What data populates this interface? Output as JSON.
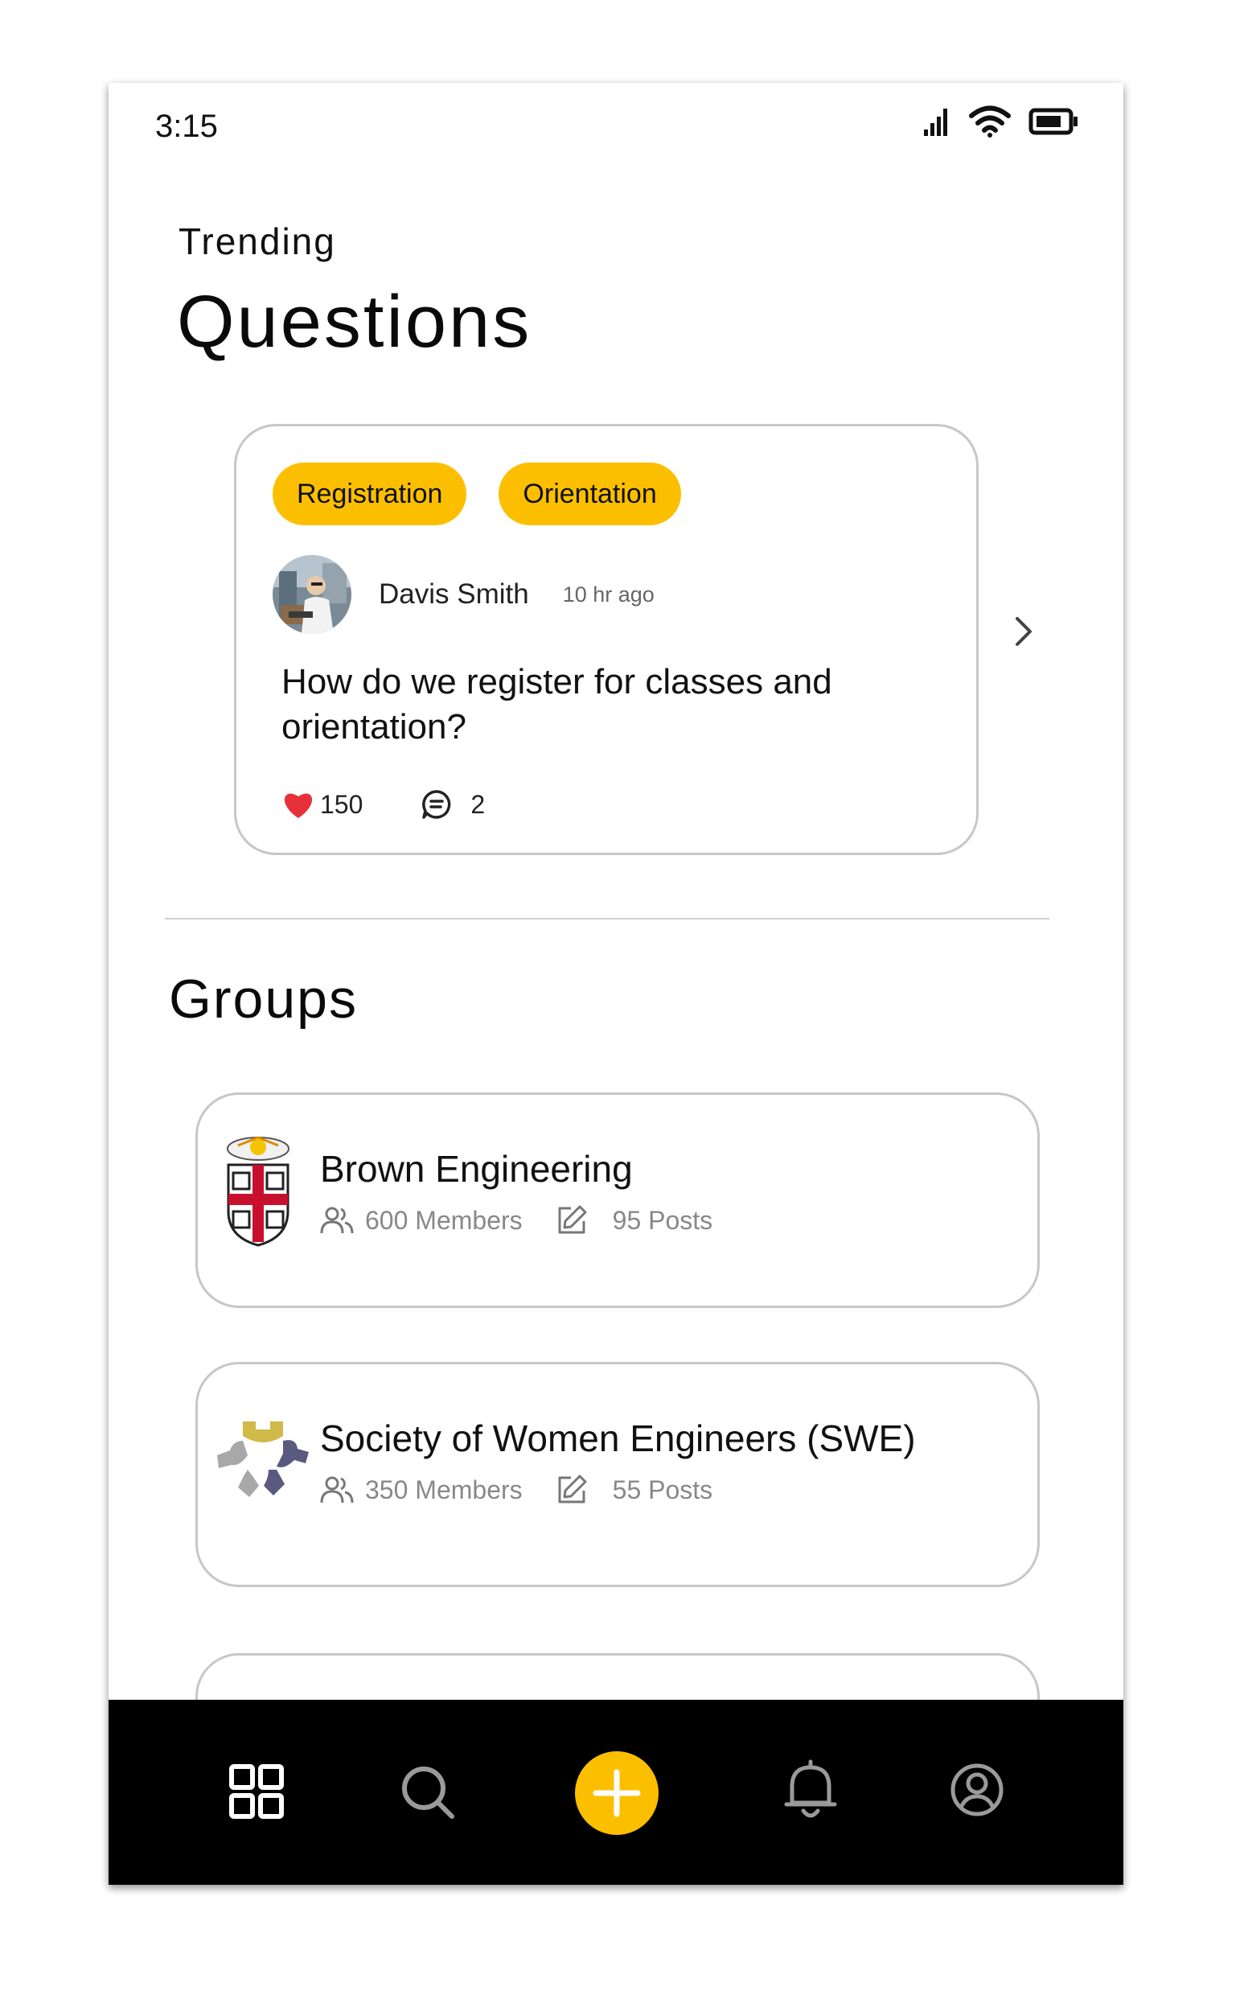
{
  "status_bar": {
    "time": "3:15"
  },
  "header": {
    "label": "Trending",
    "title": "Questions"
  },
  "question": {
    "tags": [
      "Registration",
      "Orientation"
    ],
    "author": "Davis Smith",
    "time": "10 hr ago",
    "text": "How do we register for classes and orientation?",
    "likes": "150",
    "comments": "2"
  },
  "groups": {
    "title": "Groups",
    "items": [
      {
        "name": "Brown Engineering",
        "members": "600 Members",
        "posts": "95 Posts"
      },
      {
        "name": "Society of Women Engineers (SWE)",
        "members": "350 Members",
        "posts": "55 Posts"
      }
    ]
  },
  "icons": {
    "nav": [
      "grid-icon",
      "search-icon",
      "plus-icon",
      "bell-icon",
      "profile-icon"
    ],
    "status": [
      "signal-icon",
      "wifi-icon",
      "battery-icon"
    ]
  },
  "colors": {
    "accent": "#fcbf00",
    "heart": "#e8303a",
    "nav_bg": "#000000"
  }
}
